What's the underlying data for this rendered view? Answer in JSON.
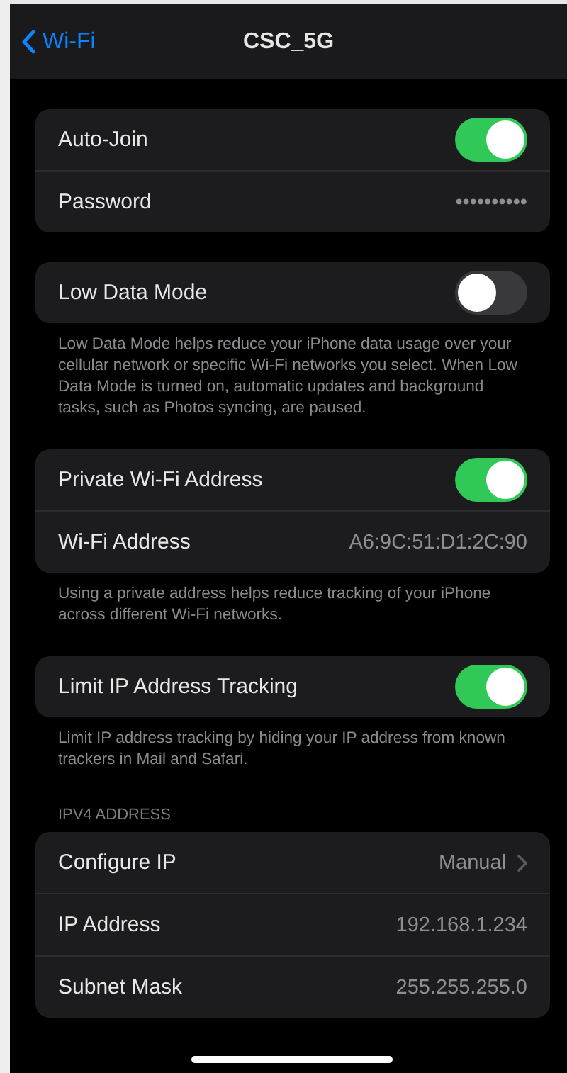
{
  "nav": {
    "back_label": "Wi-Fi",
    "title": "CSC_5G"
  },
  "sections": [
    {
      "rows": [
        {
          "kind": "toggle",
          "label": "Auto-Join",
          "on": true
        },
        {
          "kind": "value",
          "label": "Password",
          "value": "••••••••••"
        }
      ]
    },
    {
      "rows": [
        {
          "kind": "toggle",
          "label": "Low Data Mode",
          "on": false
        }
      ],
      "footer": "Low Data Mode helps reduce your iPhone data usage over your cellular network or specific Wi-Fi networks you select. When Low Data Mode is turned on, automatic updates and background tasks, such as Photos syncing, are paused."
    },
    {
      "rows": [
        {
          "kind": "toggle",
          "label": "Private Wi-Fi Address",
          "on": true
        },
        {
          "kind": "value",
          "label": "Wi-Fi Address",
          "value": "A6:9C:51:D1:2C:90"
        }
      ],
      "footer": "Using a private address helps reduce tracking of your iPhone across different Wi-Fi networks."
    },
    {
      "rows": [
        {
          "kind": "toggle",
          "label": "Limit IP Address Tracking",
          "on": true
        }
      ],
      "footer": "Limit IP address tracking by hiding your IP address from known trackers in Mail and Safari."
    },
    {
      "header": "IPV4 ADDRESS",
      "rows": [
        {
          "kind": "link",
          "label": "Configure IP",
          "value": "Manual"
        },
        {
          "kind": "value",
          "label": "IP Address",
          "value": "192.168.1.234"
        },
        {
          "kind": "value",
          "label": "Subnet Mask",
          "value": "255.255.255.0"
        }
      ]
    }
  ]
}
